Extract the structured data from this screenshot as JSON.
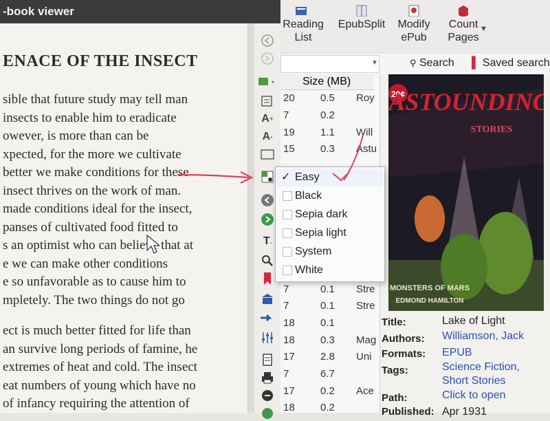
{
  "viewer": {
    "title": "-book viewer",
    "chapter_title": "ENACE OF THE INSECT",
    "paragraph1": [
      "sible that future study may tell man",
      " insects to enable him to eradicate",
      "owever, is more than can be",
      "xpected, for the more we cultivate",
      "better we make conditions for these",
      " insect thrives on the work of man.",
      "made conditions ideal for the insect,",
      "panses of cultivated food fitted to",
      "s an optimist who can believe that at",
      "e we can make other conditions",
      "e so unfavorable as to cause him to",
      "mpletely. The two things do not go"
    ],
    "paragraph2": [
      "ect is much better fitted for life than",
      "an survive long periods of famine, he",
      "extremes of heat and cold. The insect",
      "eat numbers of young which have no",
      "of infancy requiring the attention of"
    ],
    "toolbar_icons": [
      "back-icon",
      "forward-icon",
      "toc-icon",
      "toc-menu-chevron-icon",
      "bookmarks-icon",
      "font-larger-icon",
      "font-smaller-icon",
      "fullscreen-icon",
      "theme-icon",
      "previous-icon",
      "next-icon",
      "text-select-icon",
      "search-icon",
      "bookmark-icon",
      "reference-icon",
      "pointer-icon",
      "preferences-icon",
      "print-icon",
      "copy-icon"
    ],
    "theme_menu": {
      "items": [
        {
          "label": "Easy",
          "checked": true
        },
        {
          "label": "Black",
          "checked": false
        },
        {
          "label": "Sepia dark",
          "checked": false
        },
        {
          "label": "Sepia light",
          "checked": false
        },
        {
          "label": "System",
          "checked": false
        },
        {
          "label": "White",
          "checked": false
        }
      ]
    }
  },
  "calibre": {
    "toolbar": [
      {
        "label": "Reading\nList",
        "icon": "reading-list-icon"
      },
      {
        "label": "EpubSplit",
        "icon": "epubsplit-icon"
      },
      {
        "label": "Modify\nePub",
        "icon": "modify-epub-icon"
      },
      {
        "label": "Count\nPages",
        "icon": "count-pages-icon"
      }
    ],
    "search": {
      "label": "Search",
      "saved_label": "Saved search"
    },
    "table": {
      "header": "Size (MB)",
      "rows": [
        {
          "a": "20",
          "size": "0.5",
          "b": "Roy"
        },
        {
          "a": "7",
          "size": "0.2",
          "b": ""
        },
        {
          "a": "19",
          "size": "1.1",
          "b": "Will"
        },
        {
          "a": "15",
          "size": "0.3",
          "b": "Astu"
        },
        {
          "a": "7",
          "size": "0.1",
          "b": "Stre"
        },
        {
          "a": "7",
          "size": "0.1",
          "b": "Stre"
        },
        {
          "a": "18",
          "size": "0.1",
          "b": ""
        },
        {
          "a": "18",
          "size": "0.3",
          "b": "Mag"
        },
        {
          "a": "17",
          "size": "2.8",
          "b": "Uni"
        },
        {
          "a": "7",
          "size": "6.7",
          "b": ""
        },
        {
          "a": "17",
          "size": "0.2",
          "b": "Ace"
        },
        {
          "a": "18",
          "size": "0.2",
          "b": ""
        }
      ]
    },
    "cover": {
      "price": "20¢",
      "magazine": "ASTOUNDING",
      "subtitle": "STORIES",
      "story": "MONSTERS OF MARS",
      "author": "EDMOND HAMILTON"
    },
    "details": {
      "title_label": "Title:",
      "title": "Lake of Light",
      "authors_label": "Authors:",
      "authors": "Williamson, Jack",
      "formats_label": "Formats:",
      "formats": "EPUB",
      "tags_label": "Tags:",
      "tags": "Science Fiction,\nShort Stories",
      "path_label": "Path:",
      "path": "Click to open",
      "published_label": "Published:",
      "published": "Apr 1931"
    }
  },
  "colors": {
    "annotation": "#e0405a",
    "link": "#2a4fb5",
    "cover_red": "#c0192e",
    "cover_bg": "#1c1a24"
  }
}
